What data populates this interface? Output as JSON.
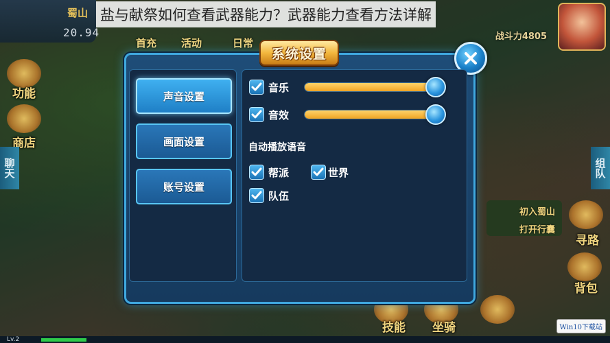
{
  "watermark": {
    "title": "盐与献祭如何查看武器能力？武器能力查看方法详解"
  },
  "hud": {
    "location": "蜀山",
    "coords": "20.94",
    "top_buttons": [
      "首充",
      "活动",
      "日常"
    ],
    "power_label": "战斗力4805"
  },
  "left_side": {
    "skills": "功能",
    "shop": "商店",
    "chat": "聊天"
  },
  "right_side": {
    "group": "组队",
    "quest_line1": "初入蜀山",
    "quest_line2": "打开行囊",
    "pathfind": "寻路",
    "bag": "背包"
  },
  "bottom": {
    "level": "Lv.2",
    "exp_progress": 0.08,
    "skills": "技能",
    "mount": "坐骑",
    "win10_badge": "Win10下载站"
  },
  "dialog": {
    "title": "系统设置",
    "tabs": [
      {
        "label": "声音设置",
        "active": true
      },
      {
        "label": "画面设置",
        "active": false
      },
      {
        "label": "账号设置",
        "active": false
      }
    ],
    "music": {
      "label": "音乐",
      "checked": true,
      "volume": 1.0
    },
    "sfx": {
      "label": "音效",
      "checked": true,
      "volume": 1.0
    },
    "auto_voice_heading": "自动播放语音",
    "voice_options": [
      {
        "label": "帮派",
        "checked": true
      },
      {
        "label": "世界",
        "checked": true
      },
      {
        "label": "队伍",
        "checked": true
      }
    ]
  },
  "colors": {
    "accent_blue": "#3fa8df",
    "slider_fill": "#f0a424",
    "title_gold": "#f3b73e"
  }
}
